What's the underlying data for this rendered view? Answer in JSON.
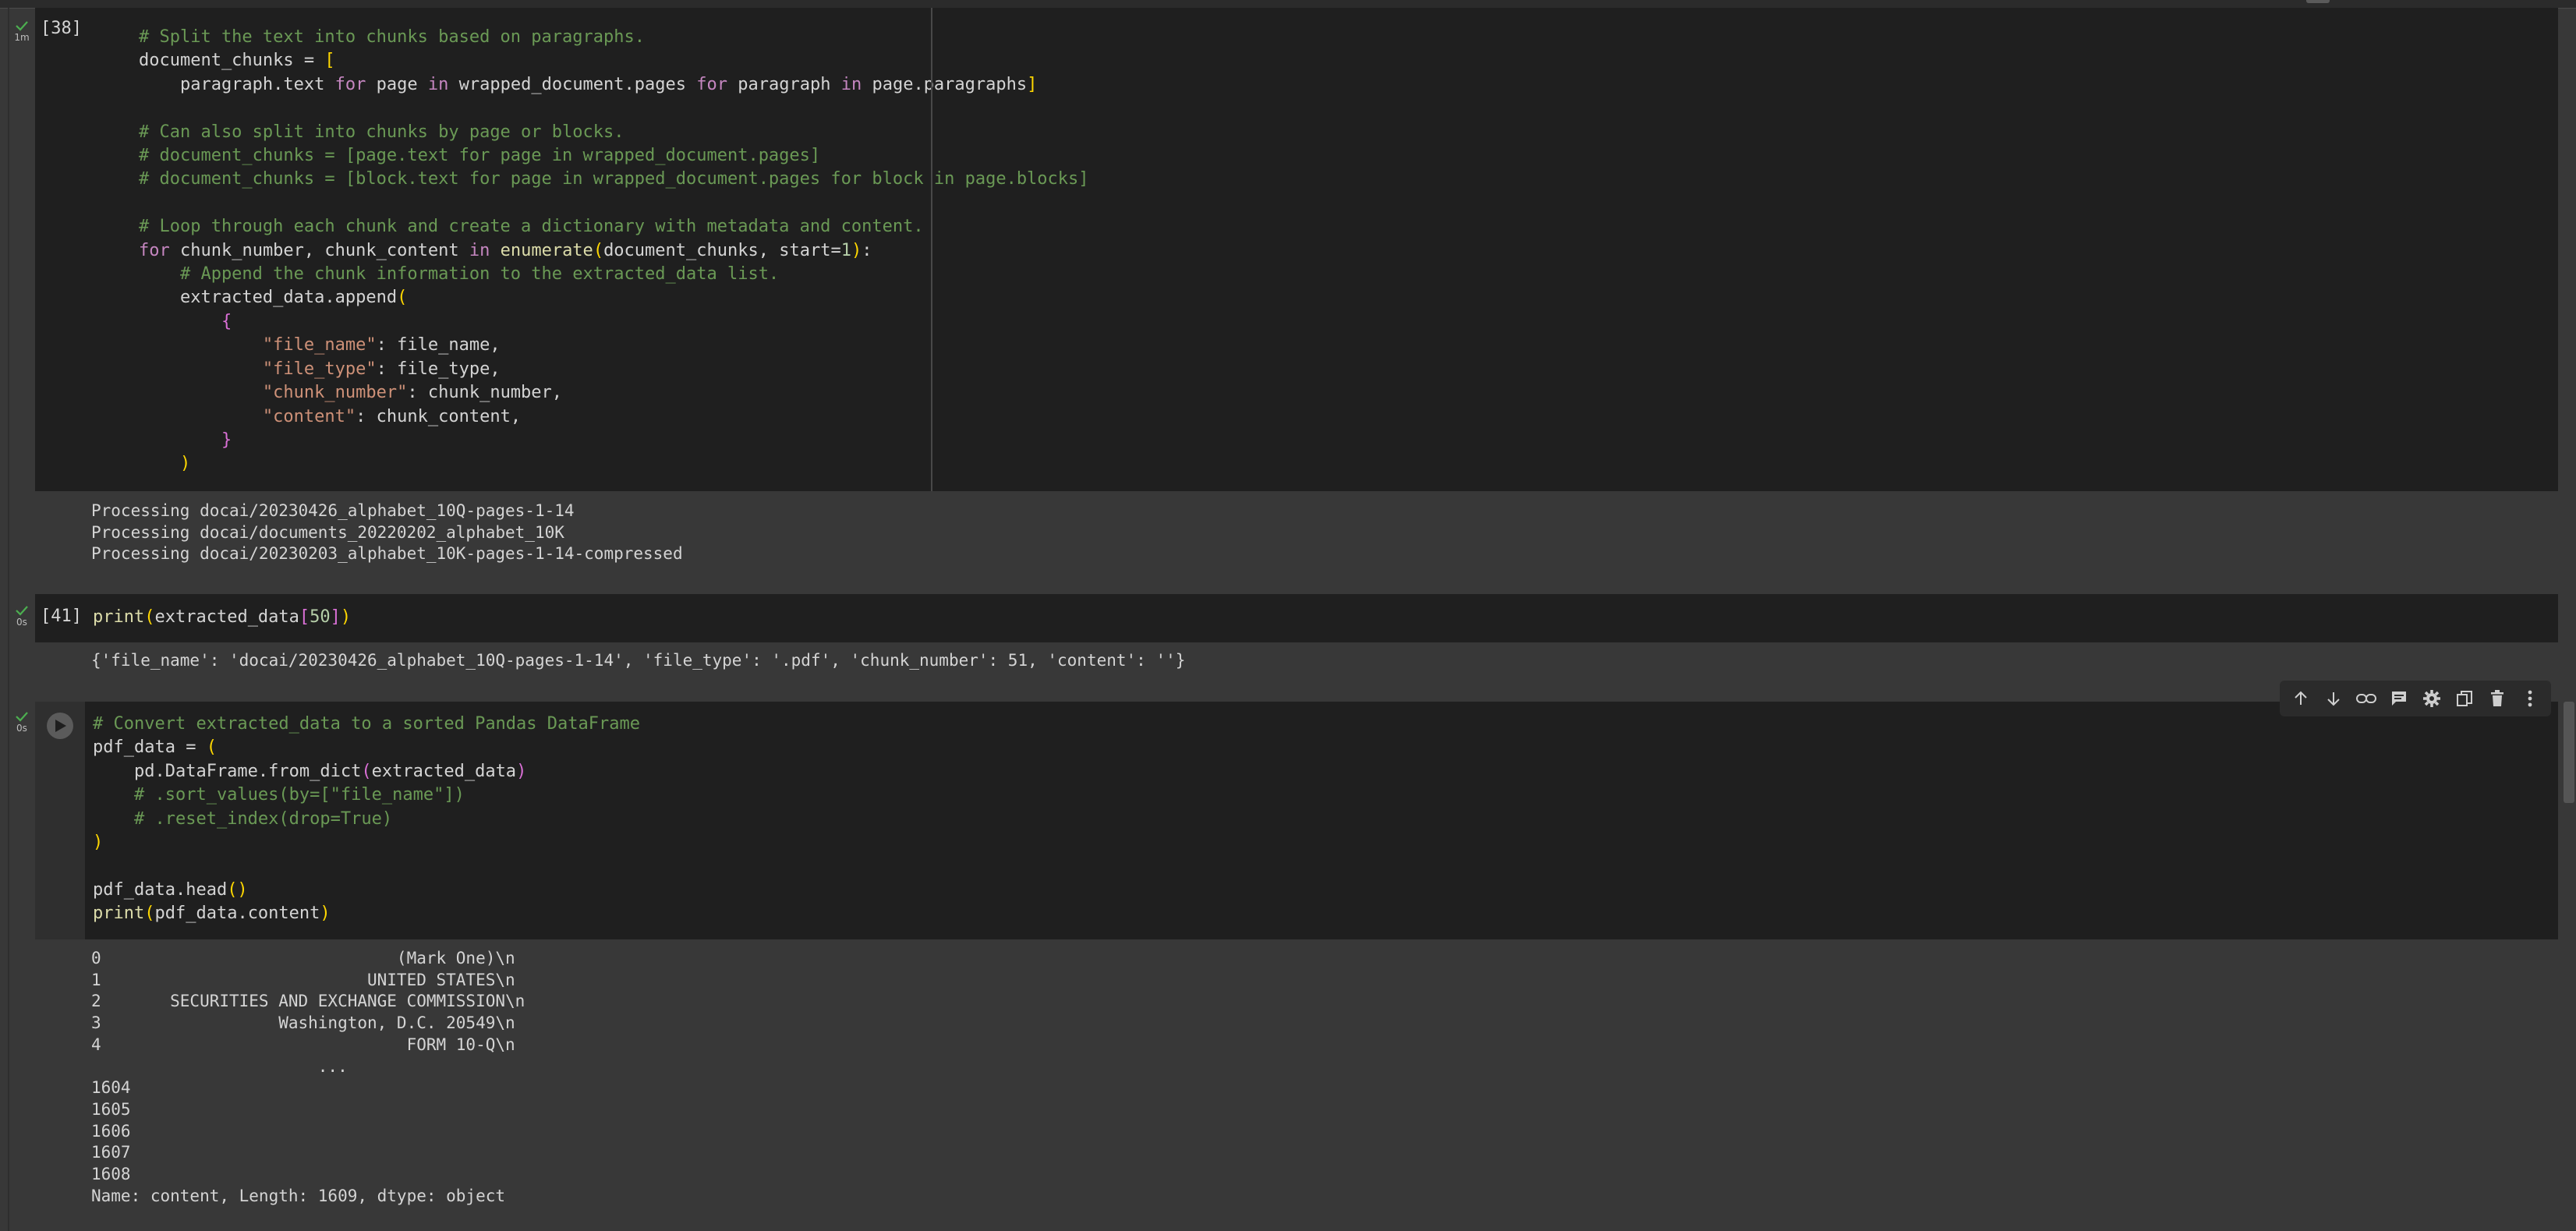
{
  "cells": [
    {
      "exec_count": "[38]",
      "duration": "1m",
      "code_lines": [
        "    # Split the text into chunks based on paragraphs.",
        "    document_chunks = [",
        "        paragraph.text for page in wrapped_document.pages for paragraph in page.paragraphs]",
        "",
        "    # Can also split into chunks by page or blocks.",
        "    # document_chunks = [page.text for page in wrapped_document.pages]",
        "    # document_chunks = [block.text for page in wrapped_document.pages for block in page.blocks]",
        "",
        "    # Loop through each chunk and create a dictionary with metadata and content.",
        "    for chunk_number, chunk_content in enumerate(document_chunks, start=1):",
        "        # Append the chunk information to the extracted_data list.",
        "        extracted_data.append(",
        "            {",
        "                \"file_name\": file_name,",
        "                \"file_type\": file_type,",
        "                \"chunk_number\": chunk_number,",
        "                \"content\": chunk_content,",
        "            }",
        "        )"
      ],
      "output_lines": [
        "Processing docai/20230426_alphabet_10Q-pages-1-14",
        "Processing docai/documents_20220202_alphabet_10K",
        "Processing docai/20230203_alphabet_10K-pages-1-14-compressed"
      ]
    },
    {
      "exec_count": "[41]",
      "duration": "0s",
      "code_lines": [
        "print(extracted_data[50])"
      ],
      "output_lines": [
        "{'file_name': 'docai/20230426_alphabet_10Q-pages-1-14', 'file_type': '.pdf', 'chunk_number': 51, 'content': ''}"
      ]
    },
    {
      "exec_count": "",
      "duration": "0s",
      "code_lines": [
        "# Convert extracted_data to a sorted Pandas DataFrame",
        "pdf_data = (",
        "    pd.DataFrame.from_dict(extracted_data)",
        "    # .sort_values(by=[\"file_name\"])",
        "    # .reset_index(drop=True)",
        ")",
        "",
        "pdf_data.head()",
        "print(pdf_data.content)"
      ],
      "output_lines": [
        "0                              (Mark One)\\n",
        "1                           UNITED STATES\\n",
        "2       SECURITIES AND EXCHANGE COMMISSION\\n",
        "3                  Washington, D.C. 20549\\n",
        "4                               FORM 10-Q\\n",
        "                       ...",
        "1604",
        "1605",
        "1606",
        "1607",
        "1608",
        "Name: content, Length: 1609, dtype: object"
      ]
    }
  ],
  "toolbar_icons": [
    "move-up-icon",
    "move-down-icon",
    "link-icon",
    "comment-icon",
    "settings-icon",
    "mirror-cell-icon",
    "delete-icon",
    "more-icon"
  ],
  "colors": {
    "code_bg": "#1f1f1f",
    "output_bg": "#383838",
    "comment": "#6a9955",
    "keyword": "#c586c0",
    "string": "#ce9178",
    "number": "#b5cea8",
    "success_check": "#4caf50"
  }
}
